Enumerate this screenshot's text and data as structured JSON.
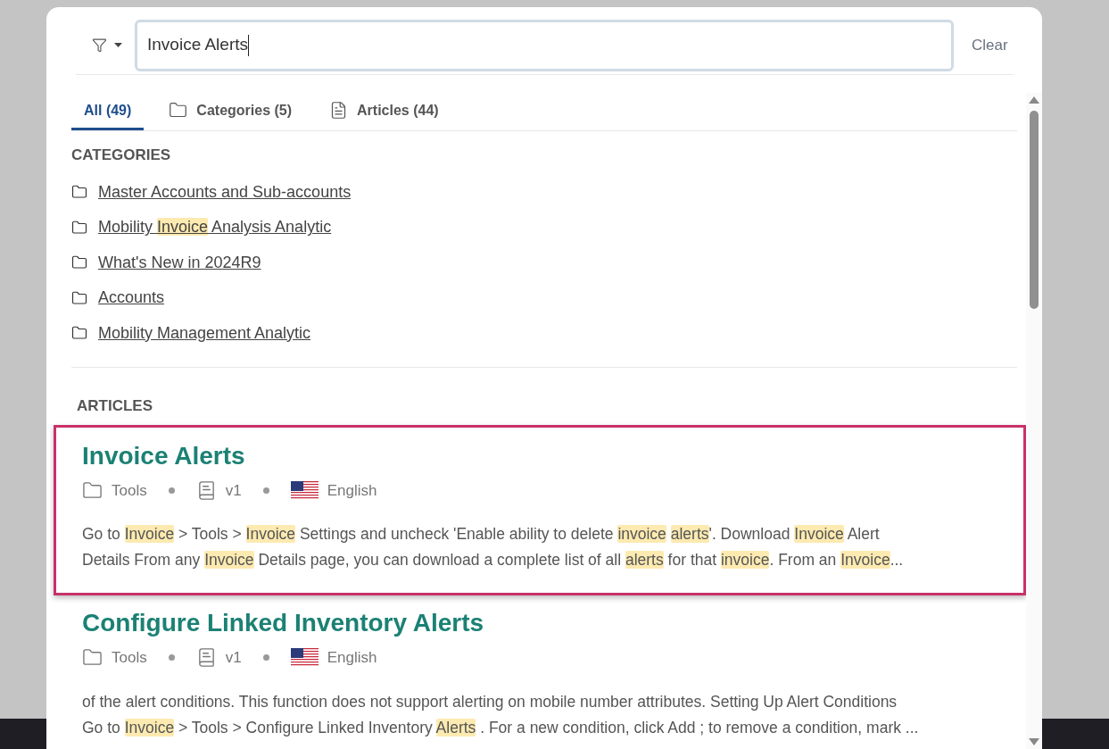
{
  "search": {
    "value": "Invoice Alerts",
    "clear_label": "Clear"
  },
  "tabs": [
    {
      "label": "All (49)",
      "kind": "all",
      "selected": true
    },
    {
      "label": "Categories (5)",
      "kind": "folder",
      "selected": false
    },
    {
      "label": "Articles (44)",
      "kind": "document",
      "selected": false
    }
  ],
  "categories": {
    "heading": "CATEGORIES",
    "items": [
      [
        {
          "text": "Master Accounts and Sub-accounts",
          "highlighted": false
        }
      ],
      [
        {
          "text": "Mobility ",
          "highlighted": false
        },
        {
          "text": "Invoice",
          "highlighted": true
        },
        {
          "text": " Analysis Analytic",
          "highlighted": false
        }
      ],
      [
        {
          "text": "What's New in 2024R9",
          "highlighted": false
        }
      ],
      [
        {
          "text": "Accounts",
          "highlighted": false
        }
      ],
      [
        {
          "text": "Mobility Management Analytic",
          "highlighted": false
        }
      ]
    ]
  },
  "articles": {
    "heading": "ARTICLES",
    "items": [
      {
        "title": "Invoice Alerts",
        "selected": true,
        "category": "Tools",
        "version": "v1",
        "language": "English",
        "lines": [
          [
            {
              "text": "Go to ",
              "highlighted": false
            },
            {
              "text": "Invoice",
              "highlighted": true
            },
            {
              "text": " > Tools > ",
              "highlighted": false
            },
            {
              "text": "Invoice",
              "highlighted": true
            },
            {
              "text": " Settings and uncheck 'Enable ability to delete ",
              "highlighted": false
            },
            {
              "text": "invoice",
              "highlighted": true
            },
            {
              "text": "alerts",
              "highlighted": true,
              "gap_before": true
            },
            {
              "text": "'. Download ",
              "highlighted": false
            },
            {
              "text": "Invoice",
              "highlighted": true
            },
            {
              "text": " Alert",
              "highlighted": false
            }
          ],
          [
            {
              "text": "Details From any ",
              "highlighted": false
            },
            {
              "text": "Invoice",
              "highlighted": true
            },
            {
              "text": " Details page, you can download a complete list of all ",
              "highlighted": false
            },
            {
              "text": "alerts",
              "highlighted": true
            },
            {
              "text": " for that ",
              "highlighted": false
            },
            {
              "text": "invoice",
              "highlighted": true
            },
            {
              "text": ". From an ",
              "highlighted": false
            },
            {
              "text": "Invoice",
              "highlighted": true
            },
            {
              "text": "...",
              "highlighted": false
            }
          ]
        ]
      },
      {
        "title": "Configure Linked Inventory Alerts",
        "selected": false,
        "category": "Tools",
        "version": "v1",
        "language": "English",
        "lines": [
          [
            {
              "text": "of the alert conditions. This function does not support alerting on mobile number attributes. Setting Up Alert Conditions",
              "highlighted": false
            }
          ],
          [
            {
              "text": "Go to ",
              "highlighted": false
            },
            {
              "text": "Invoice",
              "highlighted": true
            },
            {
              "text": " > Tools > Configure Linked Inventory ",
              "highlighted": false
            },
            {
              "text": "Alerts",
              "highlighted": true
            },
            {
              "text": " . For a new condition, click Add ; to remove a condition, mark ...",
              "highlighted": false
            }
          ]
        ]
      }
    ]
  }
}
